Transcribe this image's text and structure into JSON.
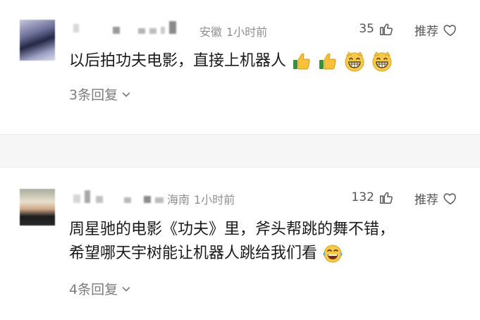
{
  "comments": [
    {
      "location": "安徽",
      "time": "1小时前",
      "likes": "35",
      "recommend_label": "推荐",
      "text": "以后拍功夫电影，直接上机器人",
      "emojis": [
        "thumbs-up",
        "thumbs-up",
        "grin",
        "grin"
      ],
      "replies_label": "3条回复"
    },
    {
      "location": "海南",
      "time": "1小时前",
      "likes": "132",
      "recommend_label": "推荐",
      "text_line1": "周星驰的电影《功夫》里，斧头帮跳的舞不错，",
      "text_line2": "希望哪天宇树能让机器人跳给我们看",
      "emojis": [
        "laughing-tears"
      ],
      "replies_label": "4条回复"
    }
  ]
}
